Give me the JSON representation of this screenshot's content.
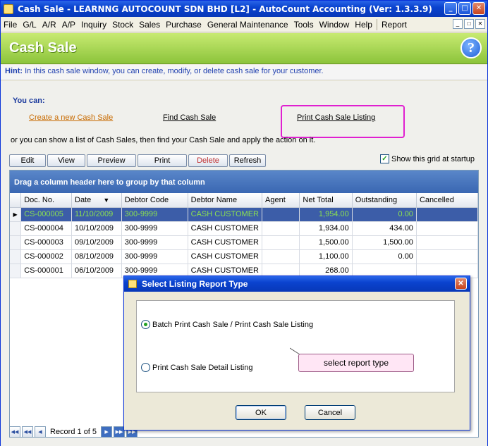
{
  "window": {
    "title": "Cash Sale - LEARNNG AUTOCOUNT SDN BHD [L2] - AutoCount Accounting (Ver: 1.3.3.9)",
    "minimize_glyph": "_",
    "maximize_glyph": "□",
    "close_glyph": "✕"
  },
  "menu": {
    "items": [
      "File",
      "G/L",
      "A/R",
      "A/P",
      "Inquiry",
      "Stock",
      "Sales",
      "Purchase",
      "General Maintenance",
      "Tools",
      "Window",
      "Help",
      "Report"
    ]
  },
  "header": {
    "title": "Cash Sale",
    "help_glyph": "?"
  },
  "hint": {
    "label": "Hint:",
    "text": "In this cash sale window, you can create, modify, or delete cash sale for your customer."
  },
  "actions": {
    "heading": "You can:",
    "create_link": "Create a new Cash Sale",
    "find_link": "Find Cash Sale",
    "print_link": "Print Cash Sale Listing",
    "or_text": "or you can show a list of Cash Sales, then find your Cash Sale and apply the action on it."
  },
  "toolbar": {
    "edit": "Edit",
    "view": "View",
    "preview": "Preview",
    "print": "Print",
    "delete": "Delete",
    "refresh": "Refresh",
    "show_grid_label": "Show this grid at startup",
    "show_grid_checked": true
  },
  "grid": {
    "group_hint": "Drag a column header here to group by that column",
    "columns": [
      "Doc. No.",
      "Date",
      "Debtor Code",
      "Debtor Name",
      "Agent",
      "Net Total",
      "Outstanding",
      "Cancelled"
    ],
    "rows": [
      {
        "doc": "CS-000005",
        "date": "11/10/2009",
        "code": "300-9999",
        "name": "CASH CUSTOMER",
        "agent": "",
        "net": "1,954.00",
        "out": "0.00",
        "cancelled": ""
      },
      {
        "doc": "CS-000004",
        "date": "10/10/2009",
        "code": "300-9999",
        "name": "CASH CUSTOMER",
        "agent": "",
        "net": "1,934.00",
        "out": "434.00",
        "cancelled": ""
      },
      {
        "doc": "CS-000003",
        "date": "09/10/2009",
        "code": "300-9999",
        "name": "CASH CUSTOMER",
        "agent": "",
        "net": "1,500.00",
        "out": "1,500.00",
        "cancelled": ""
      },
      {
        "doc": "CS-000002",
        "date": "08/10/2009",
        "code": "300-9999",
        "name": "CASH CUSTOMER",
        "agent": "",
        "net": "1,100.00",
        "out": "0.00",
        "cancelled": ""
      },
      {
        "doc": "CS-000001",
        "date": "06/10/2009",
        "code": "300-9999",
        "name": "CASH CUSTOMER",
        "agent": "",
        "net": "268.00",
        "out": "",
        "cancelled": ""
      }
    ],
    "record_text": "Record 1 of 5"
  },
  "dialog": {
    "title": "Select Listing Report Type",
    "option1": "Batch Print Cash Sale / Print Cash Sale Listing",
    "option2": "Print Cash Sale Detail Listing",
    "callout": "select report type",
    "ok": "OK",
    "cancel": "Cancel"
  },
  "colors": {
    "titlebar": "#0A43CF",
    "header_green": "#8CC43B",
    "selected_row": "#3C5DA8",
    "highlight_box": "#E020D0"
  }
}
